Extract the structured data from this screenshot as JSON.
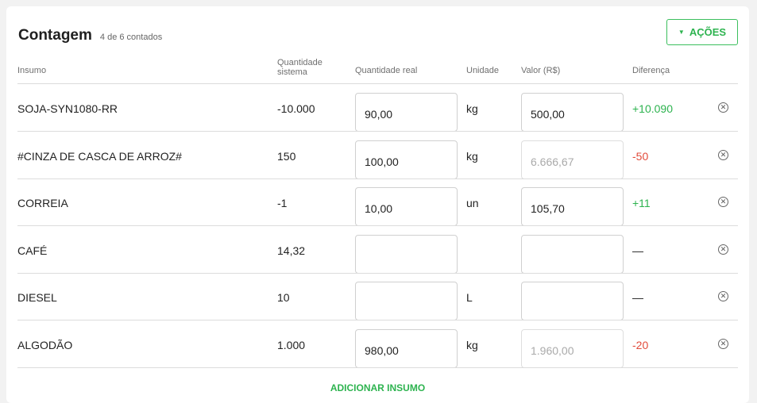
{
  "header": {
    "title": "Contagem",
    "subtitle": "4 de 6 contados",
    "actions_label": "AÇÕES"
  },
  "columns": {
    "insumo": "Insumo",
    "qsys_line1": "Quantidade",
    "qsys_line2": "sistema",
    "qreal": "Quantidade real",
    "unidade": "Unidade",
    "valor": "Valor (R$)",
    "diferenca": "Diferença"
  },
  "rows": [
    {
      "name": "SOJA-SYN1080-RR",
      "qsys": "-10.000",
      "qreal": "90,00",
      "unit": "kg",
      "value": "500,00",
      "value_disabled": false,
      "diff": "+10.090",
      "diff_type": "pos"
    },
    {
      "name": "#CINZA DE CASCA DE ARROZ#",
      "qsys": "150",
      "qreal": "100,00",
      "unit": "kg",
      "value": "6.666,67",
      "value_disabled": true,
      "diff": "-50",
      "diff_type": "neg"
    },
    {
      "name": "CORREIA",
      "qsys": "-1",
      "qreal": "10,00",
      "unit": "un",
      "value": "105,70",
      "value_disabled": false,
      "diff": "+11",
      "diff_type": "pos"
    },
    {
      "name": "CAFÉ",
      "qsys": "14,32",
      "qreal": "",
      "unit": "",
      "value": "",
      "value_disabled": false,
      "diff": "—",
      "diff_type": "none"
    },
    {
      "name": "DIESEL",
      "qsys": "10",
      "qreal": "",
      "unit": "L",
      "value": "",
      "value_disabled": false,
      "diff": "—",
      "diff_type": "none"
    },
    {
      "name": "ALGODÃO",
      "qsys": "1.000",
      "qreal": "980,00",
      "unit": "kg",
      "value": "1.960,00",
      "value_disabled": true,
      "diff": "-20",
      "diff_type": "neg"
    }
  ],
  "footer": {
    "add_label": "ADICIONAR INSUMO"
  },
  "colors": {
    "accent": "#2db34f",
    "negative": "#e24b3b"
  }
}
